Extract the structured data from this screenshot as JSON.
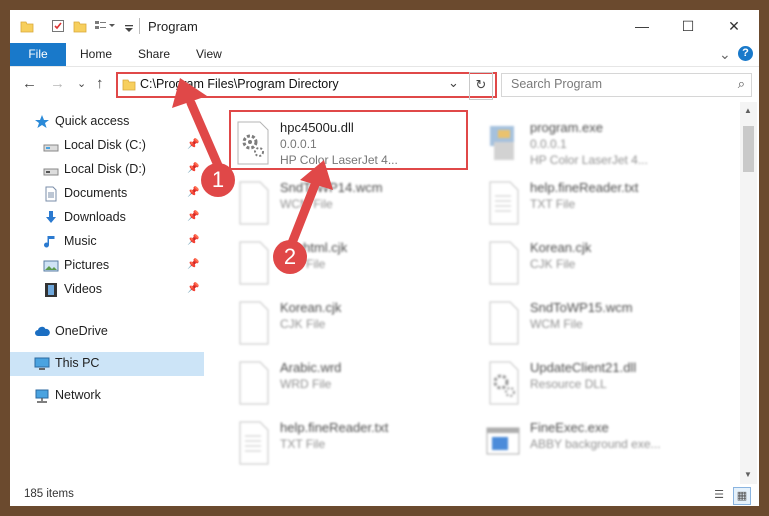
{
  "window": {
    "title": "Program",
    "controls": {
      "minimize": "—",
      "maximize": "☐",
      "close": "✕"
    }
  },
  "ribbon": {
    "tabs": [
      "File",
      "Home",
      "Share",
      "View"
    ],
    "expand_glyph": "⌄",
    "help_glyph": "?"
  },
  "address": {
    "path": "C:\\Program Files\\Program Directory",
    "dropdown_glyph": "⌄",
    "refresh_glyph": "↻",
    "back_glyph": "←",
    "forward_glyph": "→",
    "recent_glyph": "⌄",
    "up_glyph": "↑"
  },
  "search": {
    "placeholder": "Search Program",
    "icon_glyph": "⌕"
  },
  "sidebar": {
    "items": [
      {
        "label": "Quick access",
        "icon": "star-icon",
        "pinned": false
      },
      {
        "label": "Local Disk (C:)",
        "icon": "drive-icon",
        "pinned": true
      },
      {
        "label": "Local Disk (D:)",
        "icon": "drive-icon",
        "pinned": true
      },
      {
        "label": "Documents",
        "icon": "documents-icon",
        "pinned": true
      },
      {
        "label": "Downloads",
        "icon": "download-icon",
        "pinned": true
      },
      {
        "label": "Music",
        "icon": "music-icon",
        "pinned": true
      },
      {
        "label": "Pictures",
        "icon": "pictures-icon",
        "pinned": true
      },
      {
        "label": "Videos",
        "icon": "videos-icon",
        "pinned": true
      },
      {
        "label": "OneDrive",
        "icon": "cloud-icon",
        "pinned": false
      },
      {
        "label": "This PC",
        "icon": "computer-icon",
        "pinned": false,
        "selected": true
      },
      {
        "label": "Network",
        "icon": "network-icon",
        "pinned": false
      }
    ],
    "pin_glyph": "📌"
  },
  "files": [
    {
      "name": "hpc4500u.dll",
      "line1": "0.0.0.1",
      "line2": "HP Color LaserJet 4...",
      "icon": "dll-gear-icon",
      "highlighted": true
    },
    {
      "name": "program.exe",
      "line1": "0.0.0.1",
      "line2": "HP Color LaserJet 4...",
      "icon": "exe-icon"
    },
    {
      "name": "SndToWP14.wcm",
      "line1": "WCM File",
      "icon": "blank-file-icon"
    },
    {
      "name": "help.fineReader.txt",
      "line1": "TXT File",
      "icon": "text-file-icon"
    },
    {
      "name": "Enghtml.cjk",
      "line1": "CJK File",
      "icon": "blank-file-icon"
    },
    {
      "name": "Korean.cjk",
      "line1": "CJK File",
      "icon": "blank-file-icon"
    },
    {
      "name": "Korean.cjk",
      "line1": "CJK File",
      "icon": "blank-file-icon"
    },
    {
      "name": "SndToWP15.wcm",
      "line1": "WCM File",
      "icon": "blank-file-icon"
    },
    {
      "name": "Arabic.wrd",
      "line1": "WRD File",
      "icon": "blank-file-icon"
    },
    {
      "name": "UpdateClient21.dll",
      "line1": "Resource DLL",
      "icon": "dll-gear-icon"
    },
    {
      "name": "help.fineReader.txt",
      "line1": "TXT File",
      "icon": "text-file-icon"
    },
    {
      "name": "FineExec.exe",
      "line1": "ABBY background exe...",
      "icon": "window-exe-icon"
    }
  ],
  "annotations": {
    "badge1": "1",
    "badge2": "2"
  },
  "status": {
    "item_count": "185 items",
    "details_view_glyph": "☰",
    "tiles_view_glyph": "▦"
  },
  "scrollbar": {
    "up_glyph": "▲",
    "down_glyph": "▼"
  },
  "colors": {
    "accent": "#1979ca",
    "annotation_red": "#e04848",
    "selection": "#cce4f7"
  }
}
